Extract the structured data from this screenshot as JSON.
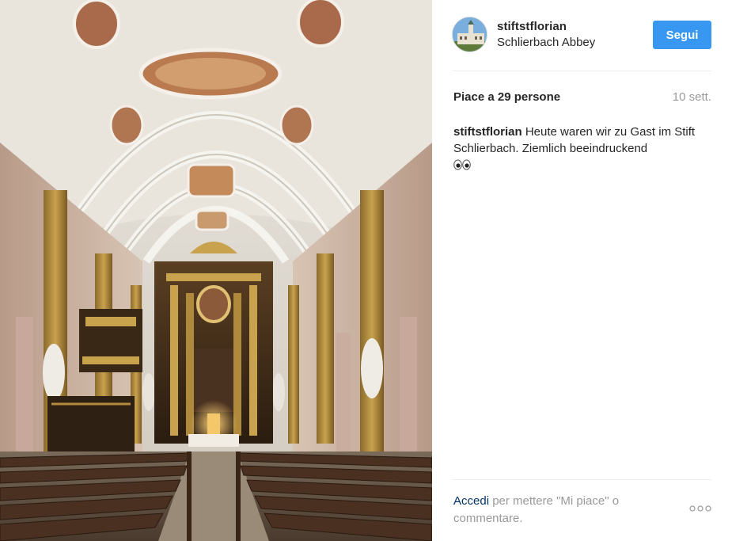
{
  "post": {
    "username": "stiftstflorian",
    "location": "Schlierbach Abbey",
    "follow_label": "Segui",
    "likes_text": "Piace a 29 persone",
    "time_ago": "10 sett.",
    "caption_user": "stiftstflorian",
    "caption_text": "Heute waren wir zu Gast im Stift Schlierbach. Ziemlich beeindruckend",
    "caption_emoji": "eyes-emoji",
    "photo_subject": "baroque-church-interior",
    "avatar_subject": "abbey-building-photo"
  },
  "footer": {
    "login_link": "Accedi",
    "login_prompt": " per mettere \"Mi piace\" o commentare.",
    "more_icon": "more-options-icon"
  },
  "colors": {
    "accent": "#3897f0",
    "link": "#003569",
    "muted": "#999999",
    "text": "#262626",
    "divider": "#efefef"
  }
}
